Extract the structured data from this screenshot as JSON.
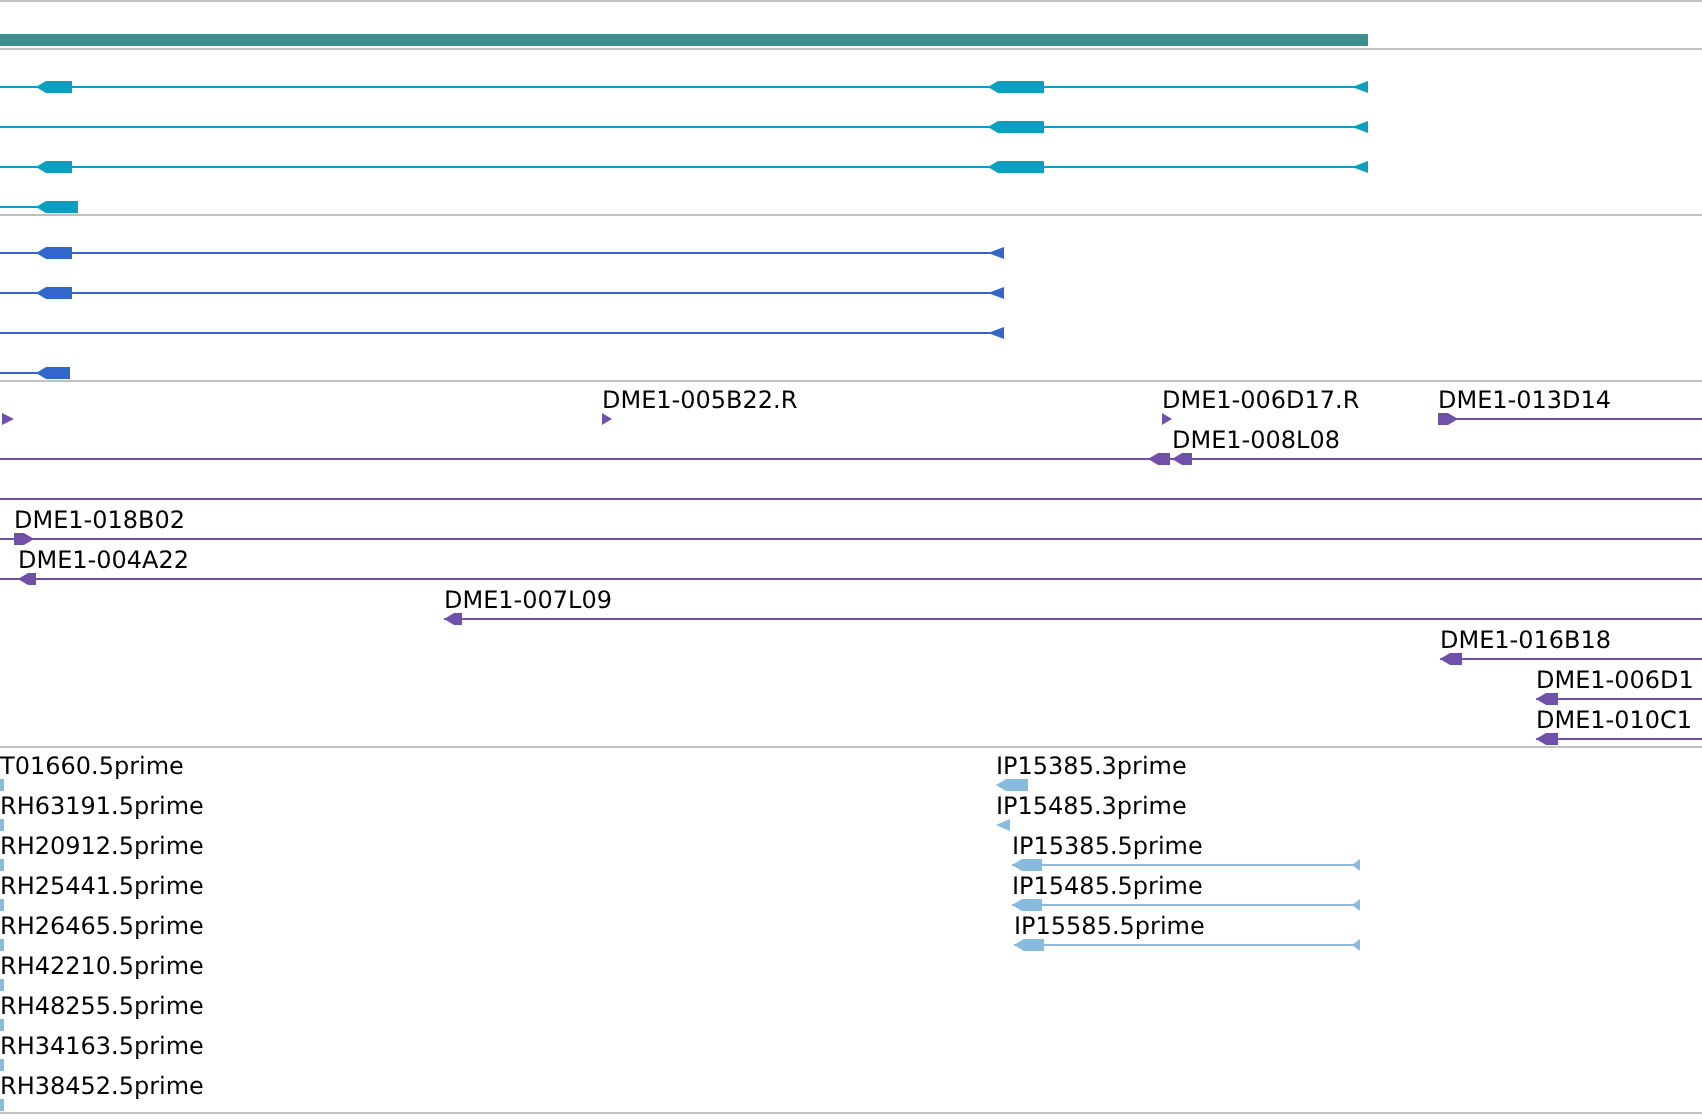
{
  "tracks": [
    {
      "kind": "summary",
      "color": "#3f8f8f"
    },
    {
      "kind": "models",
      "color": "#0aa0c0"
    },
    {
      "kind": "models",
      "color": "#3366cc"
    },
    {
      "kind": "labeled",
      "color": "#7050a8",
      "labels": [
        "DME1-005B22.R",
        "DME1-006D17.R",
        "DME1-013D14",
        "DME1-008L08",
        "DME1-018B02",
        "DME1-004A22",
        "DME1-007L09",
        "DME1-016B18",
        "DME1-006D1",
        "DME1-010C1"
      ]
    },
    {
      "kind": "labeled",
      "color": "#88bbdd",
      "labels": [
        "T01660.5prime",
        "IP15385.3prime",
        "RH63191.5prime",
        "IP15485.3prime",
        "RH20912.5prime",
        "IP15385.5prime",
        "RH25441.5prime",
        "IP15485.5prime",
        "RH26465.5prime",
        "IP15585.5prime",
        "RH42210.5prime",
        "RH48255.5prime",
        "RH34163.5prime",
        "RH38452.5prime"
      ]
    }
  ]
}
